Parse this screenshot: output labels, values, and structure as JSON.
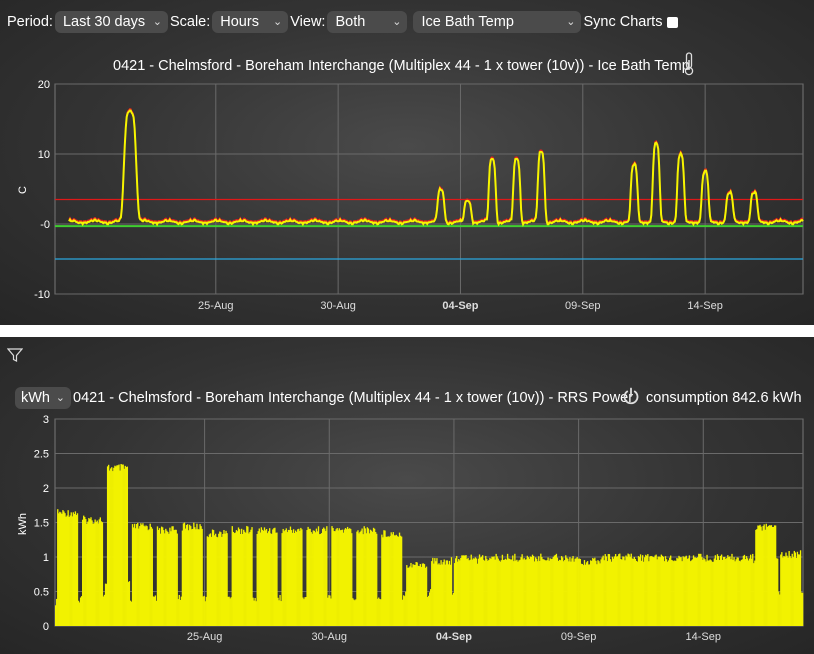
{
  "controls": {
    "period_label": "Period:",
    "period_value": "Last 30 days",
    "scale_label": "Scale:",
    "scale_value": "Hours",
    "view_label": "View:",
    "view_value": "Both",
    "sensor_value": "Ice Bath Temp",
    "sync_label": "Sync Charts"
  },
  "icons": {
    "thermometer": "thermometer-icon",
    "filter": "filter-icon",
    "power": "power-icon",
    "chevron": "chevron-down-icon"
  },
  "chart_data": [
    {
      "type": "line",
      "title": "0421 - Chelmsford - Boreham Interchange (Multiplex 44 - 1 x tower (10v)) - Ice Bath Temp",
      "ylabel": "C",
      "yticks": [
        "20",
        "10",
        "-0",
        "-10"
      ],
      "ylim": [
        -10,
        20
      ],
      "xticks": [
        {
          "label": "25-Aug",
          "day": 6,
          "bold": false
        },
        {
          "label": "30-Aug",
          "day": 11,
          "bold": false
        },
        {
          "label": "04-Sep",
          "day": 16,
          "bold": true
        },
        {
          "label": "09-Sep",
          "day": 21,
          "bold": false
        },
        {
          "label": "14-Sep",
          "day": 26,
          "bold": false
        }
      ],
      "xlim_days": [
        0,
        30
      ],
      "grid": true,
      "reference_lines": [
        {
          "value": 3.5,
          "color": "#e01818"
        },
        {
          "value": -5,
          "color": "#2aa7df"
        }
      ],
      "series": [
        {
          "color": "#f5f500",
          "peaks": [
            {
              "day": 2.5,
              "height": 16
            },
            {
              "day": 15.2,
              "height": 4.5
            },
            {
              "day": 16.3,
              "height": 3
            },
            {
              "day": 17.3,
              "height": 9
            },
            {
              "day": 18.3,
              "height": 9
            },
            {
              "day": 19.3,
              "height": 10
            },
            {
              "day": 23.1,
              "height": 8
            },
            {
              "day": 24.0,
              "height": 11
            },
            {
              "day": 25.0,
              "height": 9.5
            },
            {
              "day": 26.0,
              "height": 7
            },
            {
              "day": 27.0,
              "height": 4
            },
            {
              "day": 28.0,
              "height": 4
            }
          ]
        },
        {
          "color": "#3fcf30",
          "constant": -0.3
        }
      ]
    },
    {
      "type": "bar",
      "title": "0421 - Chelmsford - Boreham Interchange (Multiplex 44 - 1 x tower (10v)) - RRS Power",
      "consumption_text": "consumption 842.6 kWh",
      "unit_value": "kWh",
      "ylabel": "kWh",
      "yticks": [
        "3",
        "2.5",
        "2",
        "1.5",
        "1",
        "0.5",
        "0"
      ],
      "ylim": [
        0,
        3
      ],
      "xticks": [
        {
          "label": "25-Aug",
          "day": 6,
          "bold": false
        },
        {
          "label": "30-Aug",
          "day": 11,
          "bold": false
        },
        {
          "label": "04-Sep",
          "day": 16,
          "bold": true
        },
        {
          "label": "09-Sep",
          "day": 21,
          "bold": false
        },
        {
          "label": "14-Sep",
          "day": 26,
          "bold": false
        }
      ],
      "xlim_days": [
        0,
        30
      ],
      "grid": true,
      "color": "#f2f200",
      "daily_levels": [
        {
          "day": 0.5,
          "high": 1.7,
          "low": 0.3
        },
        {
          "day": 1.5,
          "high": 1.6,
          "low": 0.4
        },
        {
          "day": 2.5,
          "high": 2.35,
          "low": 0.6
        },
        {
          "day": 3.5,
          "high": 1.5,
          "low": 0.35
        },
        {
          "day": 4.5,
          "high": 1.45,
          "low": 0.35
        },
        {
          "day": 5.5,
          "high": 1.5,
          "low": 0.35
        },
        {
          "day": 6.5,
          "high": 1.4,
          "low": 0.35
        },
        {
          "day": 7.5,
          "high": 1.45,
          "low": 0.35
        },
        {
          "day": 8.5,
          "high": 1.45,
          "low": 0.35
        },
        {
          "day": 9.5,
          "high": 1.45,
          "low": 0.35
        },
        {
          "day": 10.5,
          "high": 1.45,
          "low": 0.35
        },
        {
          "day": 11.5,
          "high": 1.45,
          "low": 0.35
        },
        {
          "day": 12.5,
          "high": 1.45,
          "low": 0.35
        },
        {
          "day": 13.5,
          "high": 1.4,
          "low": 0.35
        },
        {
          "day": 14.5,
          "high": 0.95,
          "low": 0.4
        },
        {
          "day": 15.5,
          "high": 1.0,
          "low": 0.45
        },
        {
          "day": 16.5,
          "high": 1.05,
          "low": 0.9
        },
        {
          "day": 17.5,
          "high": 1.05,
          "low": 0.95
        },
        {
          "day": 18.5,
          "high": 1.05,
          "low": 0.95
        },
        {
          "day": 19.5,
          "high": 1.05,
          "low": 0.95
        },
        {
          "day": 20.5,
          "high": 1.05,
          "low": 0.95
        },
        {
          "day": 21.5,
          "high": 1.0,
          "low": 0.95
        },
        {
          "day": 22.5,
          "high": 1.05,
          "low": 0.95
        },
        {
          "day": 23.5,
          "high": 1.05,
          "low": 0.95
        },
        {
          "day": 24.5,
          "high": 1.05,
          "low": 0.95
        },
        {
          "day": 25.5,
          "high": 1.05,
          "low": 0.95
        },
        {
          "day": 26.5,
          "high": 1.05,
          "low": 0.95
        },
        {
          "day": 27.5,
          "high": 1.05,
          "low": 0.95
        },
        {
          "day": 28.5,
          "high": 1.5,
          "low": 0.9
        },
        {
          "day": 29.5,
          "high": 1.1,
          "low": 0.4
        }
      ]
    }
  ]
}
